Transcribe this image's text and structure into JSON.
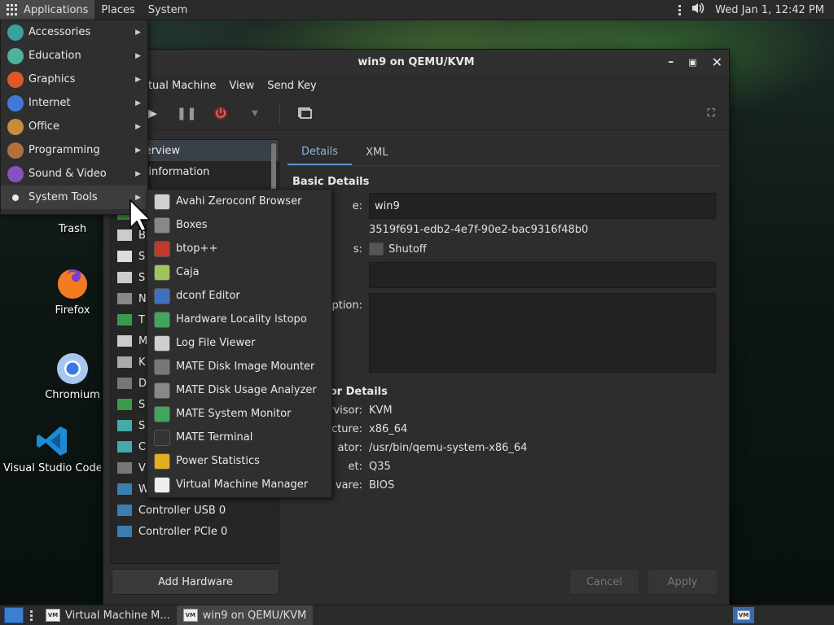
{
  "top_panel": {
    "menus": [
      "Applications",
      "Places",
      "System"
    ],
    "clock": "Wed Jan  1, 12:42 PM"
  },
  "desktop_icons": [
    {
      "label": "Trash",
      "icon": "trash-icon"
    },
    {
      "label": "Firefox",
      "icon": "firefox-icon"
    },
    {
      "label": "Chromium",
      "icon": "chromium-icon"
    },
    {
      "label": "Visual Studio Code",
      "icon": "vscode-icon"
    }
  ],
  "app_menu": {
    "items": [
      {
        "label": "Accessories",
        "icon": "accessories-icon",
        "color": "#3aa0a0"
      },
      {
        "label": "Education",
        "icon": "education-icon",
        "color": "#4fb0a0"
      },
      {
        "label": "Graphics",
        "icon": "graphics-icon",
        "color": "#e0552c"
      },
      {
        "label": "Internet",
        "icon": "internet-icon",
        "color": "#3f7bd6"
      },
      {
        "label": "Office",
        "icon": "office-icon",
        "color": "#c98a3a"
      },
      {
        "label": "Programming",
        "icon": "programming-icon",
        "color": "#b07040"
      },
      {
        "label": "Sound & Video",
        "icon": "sound-video-icon",
        "color": "#8a4fc0"
      },
      {
        "label": "System Tools",
        "icon": "system-tools-icon",
        "color": "#e8e8e8"
      }
    ],
    "submenu": [
      {
        "label": "Avahi Zeroconf Browser",
        "icon": "avahi-icon",
        "color": "#d0d0d0"
      },
      {
        "label": "Boxes",
        "icon": "boxes-icon",
        "color": "#888"
      },
      {
        "label": "btop++",
        "icon": "btop-icon",
        "color": "#c0392b"
      },
      {
        "label": "Caja",
        "icon": "caja-icon",
        "color": "#9fc55a"
      },
      {
        "label": "dconf Editor",
        "icon": "dconf-icon",
        "color": "#3f6fc0"
      },
      {
        "label": "Hardware Locality lstopo",
        "icon": "lstopo-icon",
        "color": "#3fa75a"
      },
      {
        "label": "Log File Viewer",
        "icon": "log-viewer-icon",
        "color": "#cfcfcf"
      },
      {
        "label": "MATE Disk Image Mounter",
        "icon": "disk-mounter-icon",
        "color": "#777"
      },
      {
        "label": "MATE Disk Usage Analyzer",
        "icon": "disk-usage-icon",
        "color": "#888"
      },
      {
        "label": "MATE System Monitor",
        "icon": "system-monitor-icon",
        "color": "#3fa75a"
      },
      {
        "label": "MATE Terminal",
        "icon": "terminal-icon",
        "color": "#333"
      },
      {
        "label": "Power Statistics",
        "icon": "power-stats-icon",
        "color": "#e0b020"
      },
      {
        "label": "Virtual Machine Manager",
        "icon": "vmm-icon",
        "color": "#eee"
      }
    ]
  },
  "vm_window": {
    "title": "win9 on QEMU/KVM",
    "menus": [
      "Virtual Machine",
      "View",
      "Send Key"
    ],
    "menu_visible": [
      "irtual Machine",
      "View",
      "Send Key"
    ],
    "sidebar": [
      {
        "label": "Overview",
        "visible": "verview",
        "selected": true
      },
      {
        "label": "OS information",
        "visible": "S information"
      },
      {
        "label": "",
        "visible": ""
      },
      {
        "label": "",
        "visible": "M"
      },
      {
        "label": "",
        "visible": "B"
      },
      {
        "label": "",
        "visible": "S"
      },
      {
        "label": "",
        "visible": "S"
      },
      {
        "label": "",
        "visible": "N"
      },
      {
        "label": "",
        "visible": "T"
      },
      {
        "label": "",
        "visible": "M"
      },
      {
        "label": "",
        "visible": "K"
      },
      {
        "label": "",
        "visible": "D"
      },
      {
        "label": "",
        "visible": "S"
      },
      {
        "label": "",
        "visible": "S"
      },
      {
        "label": "",
        "visible": "C"
      },
      {
        "label": "",
        "visible": "V"
      },
      {
        "label": "Watchdog",
        "visible": "Watchdog"
      },
      {
        "label": "Controller USB 0",
        "visible": "Controller USB 0"
      },
      {
        "label": "Controller PCIe 0",
        "visible": "Controller PCIe 0"
      }
    ],
    "add_hardware": "Add Hardware",
    "tabs": [
      "Details",
      "XML"
    ],
    "basic_details": {
      "heading": "Basic Details",
      "name_label": "e:",
      "name_value": "win9",
      "uuid_value": "3519f691-edb2-4e7f-90e2-bac9316f48b0",
      "status_label": "s:",
      "status_value": "Shutoff",
      "description_label": "ription:"
    },
    "hypervisor_details": {
      "heading": "sor Details",
      "rows": [
        {
          "label": "rvisor:",
          "value": "KVM"
        },
        {
          "label": "tecture:",
          "value": "x86_64"
        },
        {
          "label": "ator:",
          "value": "/usr/bin/qemu-system-x86_64"
        },
        {
          "label": "et:",
          "value": "Q35"
        },
        {
          "label": "vare:",
          "value": "BIOS"
        }
      ]
    },
    "cancel": "Cancel",
    "apply": "Apply"
  },
  "taskbar": {
    "tasks": [
      "Virtual Machine M...",
      "win9 on QEMU/KVM"
    ]
  }
}
